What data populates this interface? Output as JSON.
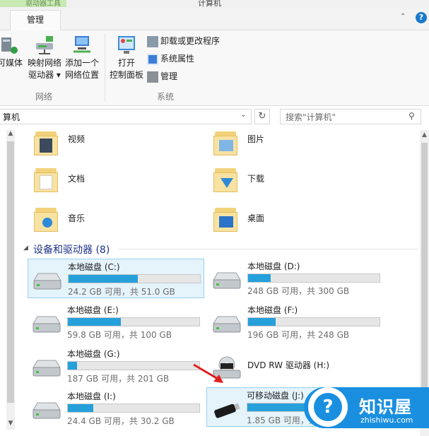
{
  "window": {
    "title": "计算机",
    "context_tab_title": "驱动器工具",
    "active_tab": "管理"
  },
  "ribbon": {
    "buttons": [
      {
        "label_line1": "可媒体",
        "label_line2": ""
      },
      {
        "label_line1": "映射网络",
        "label_line2": "驱动器 ▾"
      },
      {
        "label_line1": "添加一个",
        "label_line2": "网络位置"
      },
      {
        "label_line1": "打开",
        "label_line2": "控制面板"
      }
    ],
    "small_buttons": [
      "卸载或更改程序",
      "系统属性",
      "管理"
    ],
    "groups": [
      "网络",
      "系统"
    ]
  },
  "address": {
    "path": "算机",
    "search_placeholder": "搜索\"计算机\""
  },
  "folders": [
    {
      "name": "视频"
    },
    {
      "name": "图片"
    },
    {
      "name": "文档"
    },
    {
      "name": "下载"
    },
    {
      "name": "音乐"
    },
    {
      "name": "桌面"
    }
  ],
  "devices_section": {
    "title": "设备和驱动器 (8)"
  },
  "drives": [
    {
      "name": "本地磁盘 (C:)",
      "info": "24.2 GB 可用，共 51.0 GB",
      "used_fraction": 0.525,
      "selected": true
    },
    {
      "name": "本地磁盘 (D:)",
      "info": "248 GB 可用，共 300 GB",
      "used_fraction": 0.173
    },
    {
      "name": "本地磁盘 (E:)",
      "info": "59.8 GB 可用，共 100 GB",
      "used_fraction": 0.402
    },
    {
      "name": "本地磁盘 (F:)",
      "info": "196 GB 可用，共 248 GB",
      "used_fraction": 0.21
    },
    {
      "name": "本地磁盘 (G:)",
      "info": "187 GB 可用，共 201 GB",
      "used_fraction": 0.07
    },
    {
      "name": "DVD RW 驱动器 (H:)",
      "info": ""
    },
    {
      "name": "本地磁盘 (I:)",
      "info": "24.4 GB 可用，共 30.2 GB",
      "used_fraction": 0.192
    },
    {
      "name": "可移动磁盘 (J:)",
      "info": "1.85 GB 可用，共 ",
      "used_fraction": 0.45,
      "selected": true
    }
  ],
  "watermark": {
    "name": "知识屋",
    "url": "zhishiwu.com",
    "icon_char": "?"
  },
  "colors": {
    "accent": "#26a0da",
    "section_title": "#1e3287",
    "watermark": "#1a8fe0",
    "context_tab": "#c8e9b4"
  }
}
